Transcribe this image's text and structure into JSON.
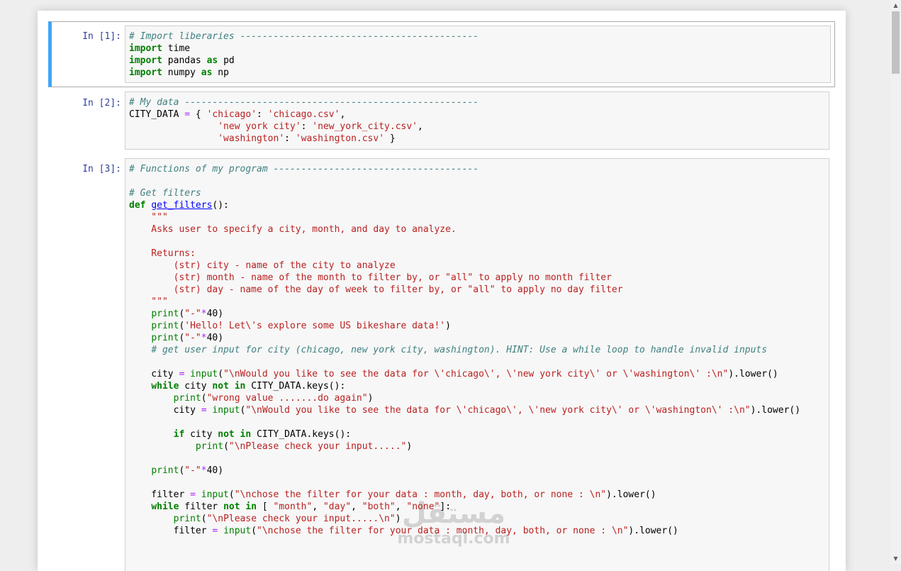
{
  "cells": [
    {
      "prompt": "In [1]:",
      "lines": [
        [
          {
            "t": "cm",
            "v": "# Import liberaries -------------------------------------------"
          }
        ],
        [
          {
            "t": "kw",
            "v": "import"
          },
          {
            "t": "nm",
            "v": " time"
          }
        ],
        [
          {
            "t": "kw",
            "v": "import"
          },
          {
            "t": "nm",
            "v": " pandas "
          },
          {
            "t": "kw",
            "v": "as"
          },
          {
            "t": "nm",
            "v": " pd"
          }
        ],
        [
          {
            "t": "kw",
            "v": "import"
          },
          {
            "t": "nm",
            "v": " numpy "
          },
          {
            "t": "kw",
            "v": "as"
          },
          {
            "t": "nm",
            "v": " np"
          }
        ]
      ]
    },
    {
      "prompt": "In [2]:",
      "lines": [
        [
          {
            "t": "cm",
            "v": "# My data -----------------------------------------------------"
          }
        ],
        [
          {
            "t": "nm",
            "v": "CITY_DATA "
          },
          {
            "t": "op",
            "v": "="
          },
          {
            "t": "nm",
            "v": " { "
          },
          {
            "t": "st",
            "v": "'chicago'"
          },
          {
            "t": "nm",
            "v": ": "
          },
          {
            "t": "st",
            "v": "'chicago.csv'"
          },
          {
            "t": "nm",
            "v": ","
          }
        ],
        [
          {
            "t": "nm",
            "v": "                "
          },
          {
            "t": "st",
            "v": "'new york city'"
          },
          {
            "t": "nm",
            "v": ": "
          },
          {
            "t": "st",
            "v": "'new_york_city.csv'"
          },
          {
            "t": "nm",
            "v": ","
          }
        ],
        [
          {
            "t": "nm",
            "v": "                "
          },
          {
            "t": "st",
            "v": "'washington'"
          },
          {
            "t": "nm",
            "v": ": "
          },
          {
            "t": "st",
            "v": "'washington.csv'"
          },
          {
            "t": "nm",
            "v": " }"
          }
        ]
      ]
    },
    {
      "prompt": "In [3]:",
      "lines": [
        [
          {
            "t": "cm",
            "v": "# Functions of my program -------------------------------------"
          }
        ],
        [],
        [
          {
            "t": "cm",
            "v": "# Get filters"
          }
        ],
        [
          {
            "t": "kw",
            "v": "def"
          },
          {
            "t": "nm",
            "v": " "
          },
          {
            "t": "fn",
            "v": "get_filters"
          },
          {
            "t": "nm",
            "v": "():"
          }
        ],
        [
          {
            "t": "st",
            "v": "    \"\"\""
          }
        ],
        [
          {
            "t": "st",
            "v": "    Asks user to specify a city, month, and day to analyze."
          }
        ],
        [],
        [
          {
            "t": "st",
            "v": "    Returns:"
          }
        ],
        [
          {
            "t": "st",
            "v": "        (str) city - name of the city to analyze"
          }
        ],
        [
          {
            "t": "st",
            "v": "        (str) month - name of the month to filter by, or \"all\" to apply no month filter"
          }
        ],
        [
          {
            "t": "st",
            "v": "        (str) day - name of the day of week to filter by, or \"all\" to apply no day filter"
          }
        ],
        [
          {
            "t": "st",
            "v": "    \"\"\""
          }
        ],
        [
          {
            "t": "nm",
            "v": "    "
          },
          {
            "t": "bi",
            "v": "print"
          },
          {
            "t": "nm",
            "v": "("
          },
          {
            "t": "st",
            "v": "\"-\""
          },
          {
            "t": "op",
            "v": "*"
          },
          {
            "t": "nm",
            "v": "40)"
          }
        ],
        [
          {
            "t": "nm",
            "v": "    "
          },
          {
            "t": "bi",
            "v": "print"
          },
          {
            "t": "nm",
            "v": "("
          },
          {
            "t": "st",
            "v": "'Hello! Let\\'s explore some US bikeshare data!'"
          },
          {
            "t": "nm",
            "v": ")"
          }
        ],
        [
          {
            "t": "nm",
            "v": "    "
          },
          {
            "t": "bi",
            "v": "print"
          },
          {
            "t": "nm",
            "v": "("
          },
          {
            "t": "st",
            "v": "\"-\""
          },
          {
            "t": "op",
            "v": "*"
          },
          {
            "t": "nm",
            "v": "40)"
          }
        ],
        [
          {
            "t": "nm",
            "v": "    "
          },
          {
            "t": "cm",
            "v": "# get user input for city (chicago, new york city, washington). HINT: Use a while loop to handle invalid inputs"
          }
        ],
        [],
        [
          {
            "t": "nm",
            "v": "    city "
          },
          {
            "t": "op",
            "v": "="
          },
          {
            "t": "nm",
            "v": " "
          },
          {
            "t": "bi",
            "v": "input"
          },
          {
            "t": "nm",
            "v": "("
          },
          {
            "t": "st",
            "v": "\"\\nWould you like to see the data for \\'chicago\\', \\'new york city\\' or \\'washington\\' :\\n\""
          },
          {
            "t": "nm",
            "v": ").lower()"
          }
        ],
        [
          {
            "t": "nm",
            "v": "    "
          },
          {
            "t": "kw",
            "v": "while"
          },
          {
            "t": "nm",
            "v": " city "
          },
          {
            "t": "kw",
            "v": "not in"
          },
          {
            "t": "nm",
            "v": " CITY_DATA.keys():"
          }
        ],
        [
          {
            "t": "nm",
            "v": "        "
          },
          {
            "t": "bi",
            "v": "print"
          },
          {
            "t": "nm",
            "v": "("
          },
          {
            "t": "st",
            "v": "\"wrong value .......do again\""
          },
          {
            "t": "nm",
            "v": ")"
          }
        ],
        [
          {
            "t": "nm",
            "v": "        city "
          },
          {
            "t": "op",
            "v": "="
          },
          {
            "t": "nm",
            "v": " "
          },
          {
            "t": "bi",
            "v": "input"
          },
          {
            "t": "nm",
            "v": "("
          },
          {
            "t": "st",
            "v": "\"\\nWould you like to see the data for \\'chicago\\', \\'new york city\\' or \\'washington\\' :\\n\""
          },
          {
            "t": "nm",
            "v": ").lower()"
          }
        ],
        [],
        [
          {
            "t": "nm",
            "v": "        "
          },
          {
            "t": "kw",
            "v": "if"
          },
          {
            "t": "nm",
            "v": " city "
          },
          {
            "t": "kw",
            "v": "not in"
          },
          {
            "t": "nm",
            "v": " CITY_DATA.keys():"
          }
        ],
        [
          {
            "t": "nm",
            "v": "            "
          },
          {
            "t": "bi",
            "v": "print"
          },
          {
            "t": "nm",
            "v": "("
          },
          {
            "t": "st",
            "v": "\"\\nPlease check your input.....\""
          },
          {
            "t": "nm",
            "v": ")"
          }
        ],
        [],
        [
          {
            "t": "nm",
            "v": "    "
          },
          {
            "t": "bi",
            "v": "print"
          },
          {
            "t": "nm",
            "v": "("
          },
          {
            "t": "st",
            "v": "\"-\""
          },
          {
            "t": "op",
            "v": "*"
          },
          {
            "t": "nm",
            "v": "40)"
          }
        ],
        [],
        [
          {
            "t": "nm",
            "v": "    filter "
          },
          {
            "t": "op",
            "v": "="
          },
          {
            "t": "nm",
            "v": " "
          },
          {
            "t": "bi",
            "v": "input"
          },
          {
            "t": "nm",
            "v": "("
          },
          {
            "t": "st",
            "v": "\"\\nchose the filter for your data : month, day, both, or none : \\n\""
          },
          {
            "t": "nm",
            "v": ").lower()"
          }
        ],
        [
          {
            "t": "nm",
            "v": "    "
          },
          {
            "t": "kw",
            "v": "while"
          },
          {
            "t": "nm",
            "v": " filter "
          },
          {
            "t": "kw",
            "v": "not in"
          },
          {
            "t": "nm",
            "v": " [ "
          },
          {
            "t": "st",
            "v": "\"month\""
          },
          {
            "t": "nm",
            "v": ", "
          },
          {
            "t": "st",
            "v": "\"day\""
          },
          {
            "t": "nm",
            "v": ", "
          },
          {
            "t": "st",
            "v": "\"both\""
          },
          {
            "t": "nm",
            "v": ", "
          },
          {
            "t": "st",
            "v": "\"none\""
          },
          {
            "t": "nm",
            "v": "]:"
          }
        ],
        [
          {
            "t": "nm",
            "v": "        "
          },
          {
            "t": "bi",
            "v": "print"
          },
          {
            "t": "nm",
            "v": "("
          },
          {
            "t": "st",
            "v": "\"\\nPlease check your input.....\\n\""
          },
          {
            "t": "nm",
            "v": ")"
          }
        ],
        [
          {
            "t": "nm",
            "v": "        filter "
          },
          {
            "t": "op",
            "v": "="
          },
          {
            "t": "nm",
            "v": " "
          },
          {
            "t": "bi",
            "v": "input"
          },
          {
            "t": "nm",
            "v": "("
          },
          {
            "t": "st",
            "v": "\"\\nchose the filter for your data : month, day, both, or none : \\n\""
          },
          {
            "t": "nm",
            "v": ").lower()"
          }
        ]
      ]
    }
  ],
  "watermark": {
    "logo": "مستقل",
    "text": "mostaql.com"
  },
  "colors": {
    "selected_cell_bar": "#42a5f5",
    "prompt": "#303f9f",
    "comment": "#408080",
    "keyword": "#008000",
    "string": "#ba2121",
    "operator": "#aa22ff"
  }
}
